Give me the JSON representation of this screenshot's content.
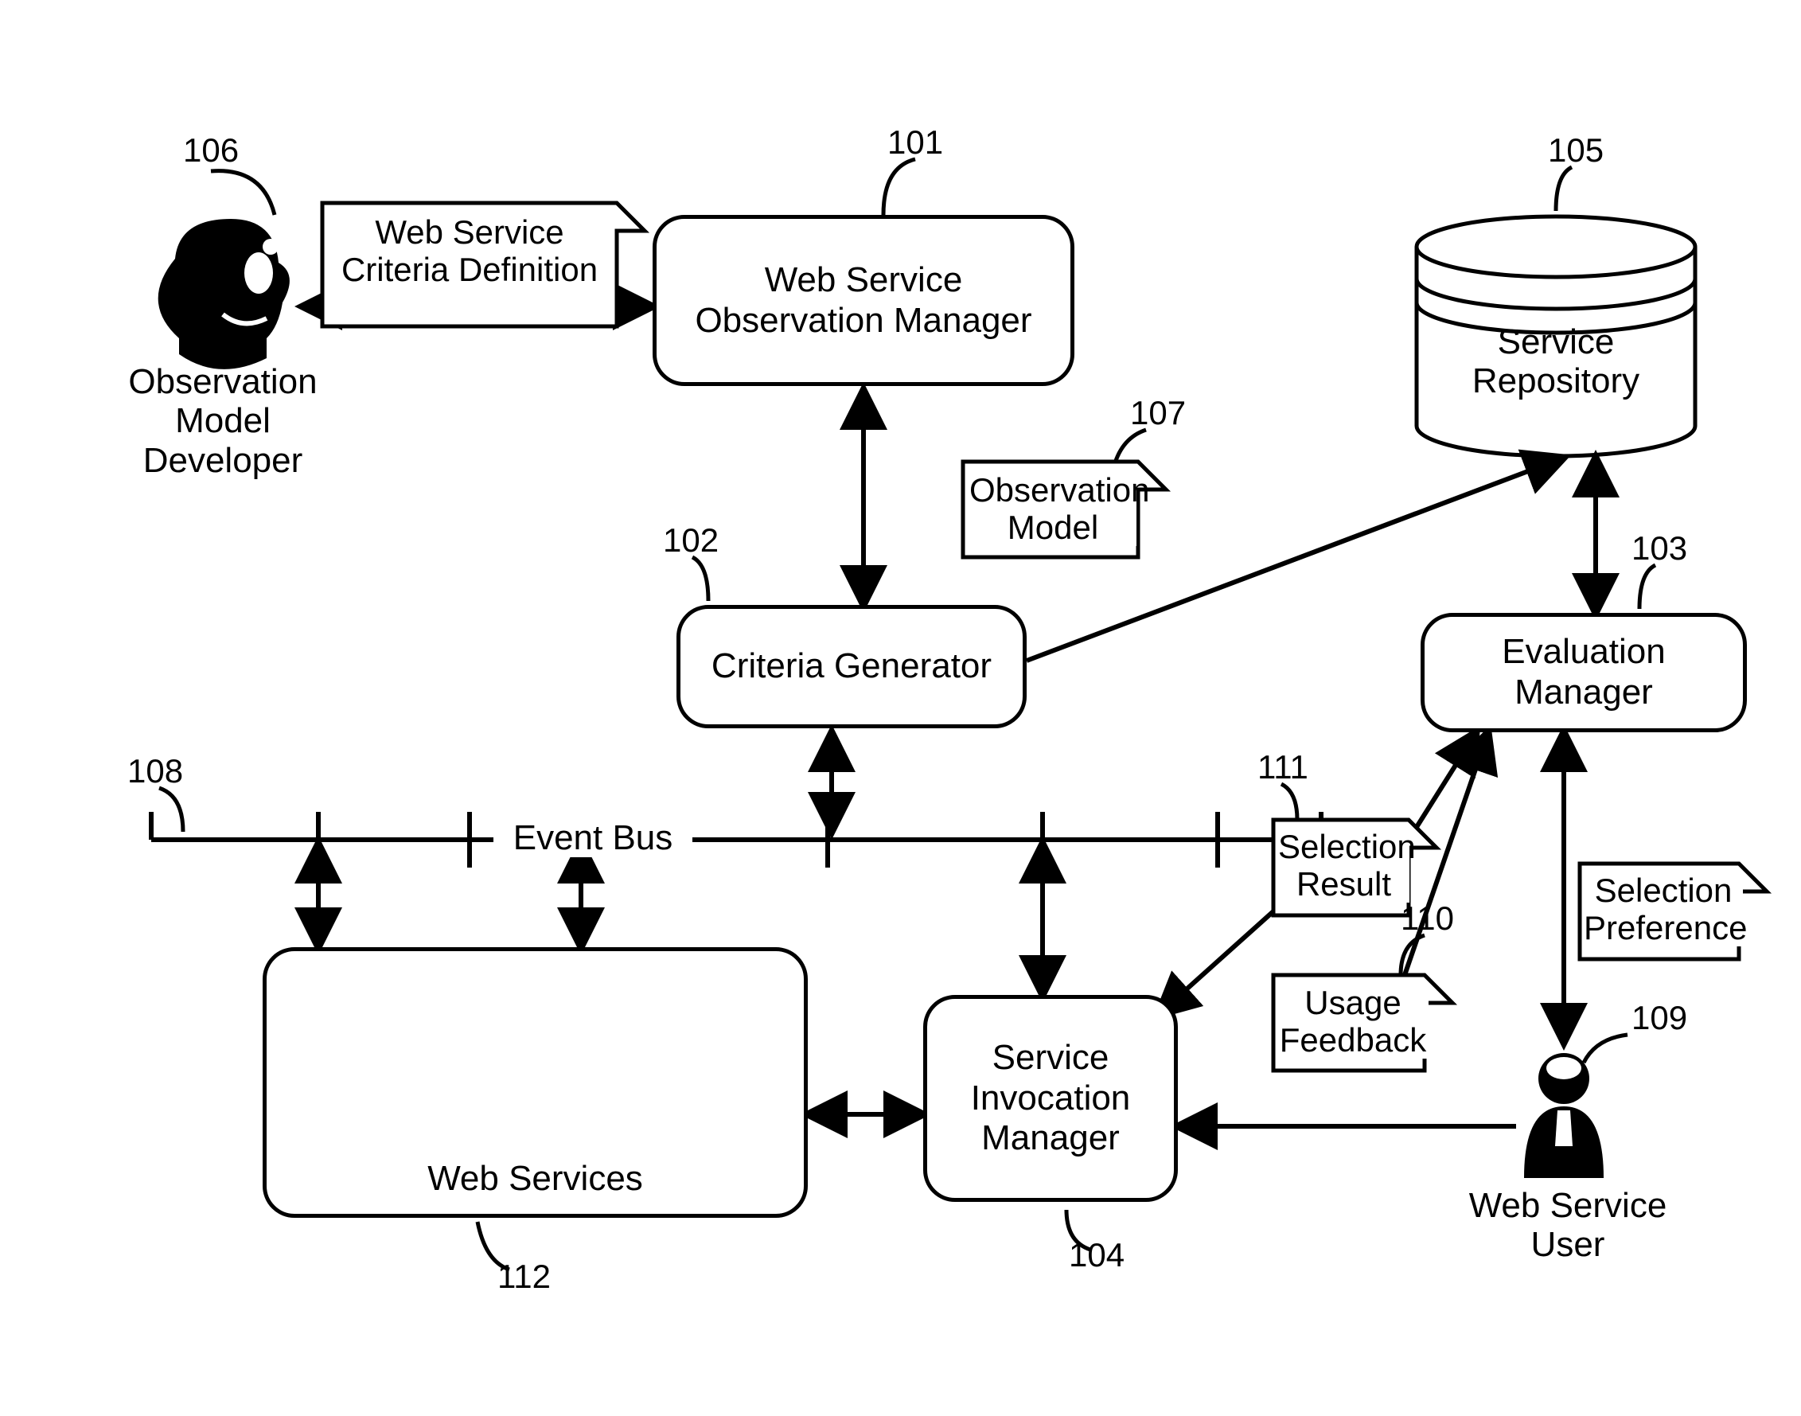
{
  "refs": {
    "r106": "106",
    "r101": "101",
    "r105": "105",
    "r107": "107",
    "r102": "102",
    "r103": "103",
    "r108": "108",
    "r111": "111",
    "r110": "110",
    "r109": "109",
    "r104": "104",
    "r112": "112"
  },
  "actors": {
    "observation_developer": "Observation\nModel\nDeveloper",
    "web_service_user": "Web Service\nUser"
  },
  "nodes": {
    "obs_manager": "Web Service\nObservation Manager",
    "criteria_generator": "Criteria Generator",
    "evaluation_manager": "Evaluation Manager",
    "invocation_manager": "Service\nInvocation\nManager",
    "web_services": "Web Services",
    "service_repository": "Service\nRepository"
  },
  "tags": {
    "criteria_definition": "Web Service\nCriteria Definition",
    "observation_model": "Observation\nModel",
    "selection_result": "Selection\nResult",
    "usage_feedback": "Usage\nFeedback",
    "selection_preference": "Selection\nPreference"
  },
  "bus": {
    "label": "Event Bus"
  }
}
